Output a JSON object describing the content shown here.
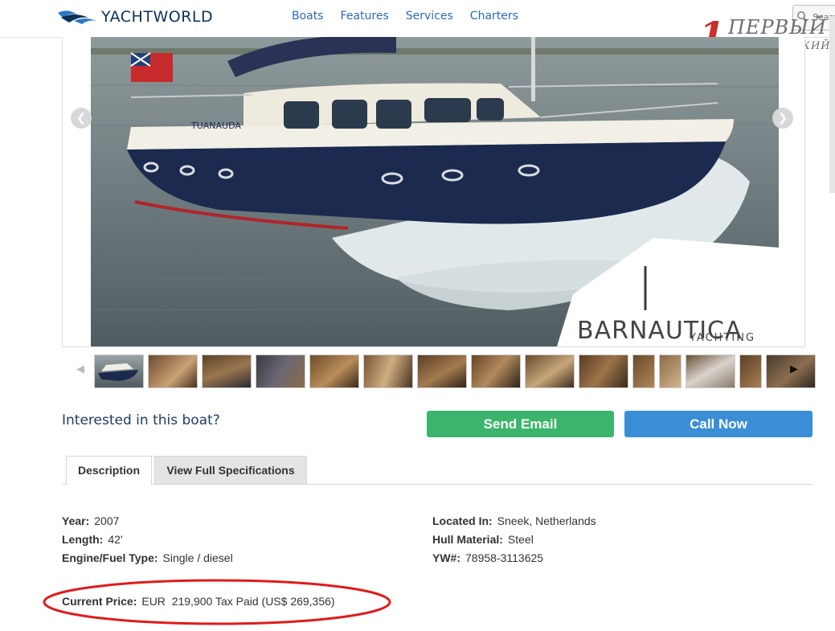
{
  "header": {
    "logo_text": "YACHTWORLD",
    "nav": [
      "Boats",
      "Features",
      "Services",
      "Charters"
    ],
    "search_placeholder": "Search"
  },
  "watermark": {
    "number": "1",
    "line1": "ПЕРВЫЙ",
    "line2": "ЗАПОРОЖСКИЙ"
  },
  "photo": {
    "brand_name": "BARNAUTICA",
    "brand_sub": "YACHTING",
    "hull_name": "TUANAUDA"
  },
  "interest": {
    "question": "Interested in this boat?",
    "send_email": "Send Email",
    "call_now": "Call Now"
  },
  "tabs": {
    "description": "Description",
    "full_specs": "View Full Specifications"
  },
  "specs": {
    "left": [
      {
        "label": "Year:",
        "value": "2007"
      },
      {
        "label": "Length:",
        "value": "42'"
      },
      {
        "label": "Engine/Fuel Type:",
        "value": "Single / diesel"
      }
    ],
    "right": [
      {
        "label": "Located In:",
        "value": "Sneek, Netherlands"
      },
      {
        "label": "Hull Material:",
        "value": "Steel"
      },
      {
        "label": "YW#:",
        "value": "78958-3113625"
      }
    ],
    "price": {
      "label": "Current Price:",
      "value": "EUR  219,900 Tax Paid (US$ 269,356)"
    }
  },
  "colors": {
    "brand_navy": "#0e3057",
    "nav_link": "#2a6bb3",
    "send_email": "#3bb56b",
    "call_now": "#3a8ed6",
    "annotation_red": "#e01b1b"
  }
}
